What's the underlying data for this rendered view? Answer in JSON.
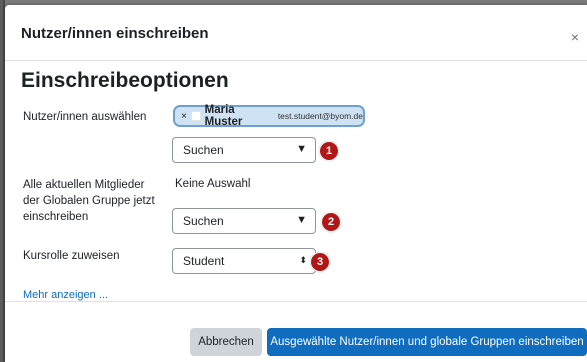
{
  "modal": {
    "title": "Nutzer/innen einschreiben",
    "close_symbol": "×"
  },
  "section": {
    "heading": "Einschreibeoptionen"
  },
  "fields": {
    "users_label": "Nutzer/innen auswählen",
    "selected_user": {
      "remove_symbol": "×",
      "name": "Maria Muster",
      "email": "test.student@byom.de"
    },
    "search_placeholder_1": "Suchen",
    "group_label": "Alle aktuellen Mitglieder der Globalen Gruppe jetzt einschreiben",
    "group_selection": "Keine Auswahl",
    "search_placeholder_2": "Suchen",
    "role_label": "Kursrolle zuweisen",
    "role_value": "Student"
  },
  "badges": [
    "1",
    "2",
    "3"
  ],
  "arrows": {
    "down": "▼",
    "updown": "⬍"
  },
  "more_link": "Mehr anzeigen ...",
  "buttons": {
    "cancel": "Abbrechen",
    "submit": "Ausgewählte Nutzer/innen und globale Gruppen einschreiben"
  },
  "colors": {
    "primary": "#0f6cbf",
    "badge": "#b01818",
    "chip_bg": "#cfe2f3"
  }
}
